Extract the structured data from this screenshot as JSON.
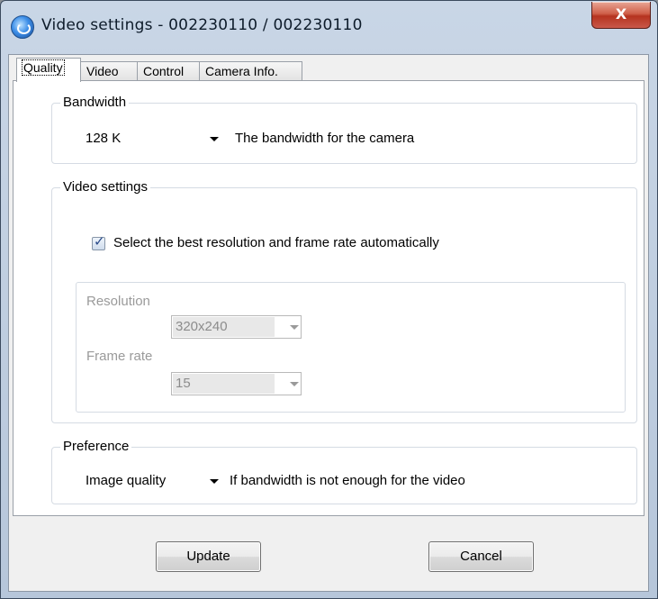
{
  "window": {
    "title": "Video settings - 002230110 / 002230110",
    "close_glyph": "X"
  },
  "tabs": [
    "Quality",
    "Video",
    "Control",
    "Camera Info."
  ],
  "bandwidth": {
    "group_label": "Bandwidth",
    "selected": "128 K",
    "description": "The bandwidth for the camera"
  },
  "video_settings": {
    "group_label": "Video settings",
    "auto_checkbox_label": "Select the best resolution and frame rate automatically",
    "auto_checked": true,
    "resolution_label": "Resolution",
    "resolution_value": "320x240",
    "frame_rate_label": "Frame rate",
    "frame_rate_value": "15"
  },
  "preference": {
    "group_label": "Preference",
    "selected": "Image quality",
    "description": "If bandwidth is not enough for the video"
  },
  "buttons": {
    "update": "Update",
    "cancel": "Cancel"
  },
  "icons": {
    "app": "camera-app-icon",
    "close": "close-icon",
    "dropdown": "chevron-down-icon",
    "check": "checkmark-icon"
  },
  "colors": {
    "close_button": "#c9463a",
    "title_bar": "#c3d2e6",
    "panel": "#ffffff"
  }
}
